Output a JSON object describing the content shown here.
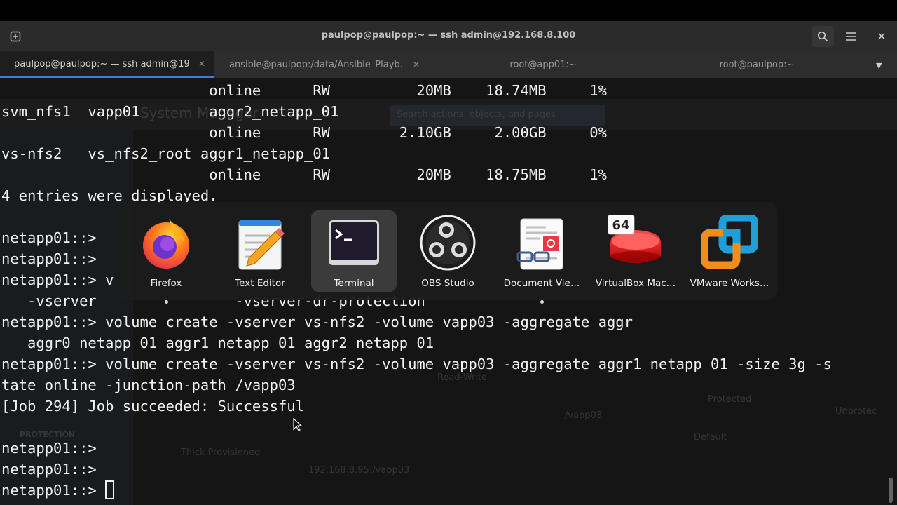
{
  "window": {
    "title": "paulpop@paulpop:~ — ssh admin@192.168.8.100"
  },
  "tabs": [
    {
      "label": "paulpop@paulpop:~ — ssh admin@19…",
      "active": true
    },
    {
      "label": "ansible@paulpop:/data/Ansible_Playb…",
      "active": false
    },
    {
      "label": "root@app01:~",
      "active": false
    },
    {
      "label": "root@paulpop:~",
      "active": false
    }
  ],
  "terminal": {
    "lines": [
      "                        online      RW          20MB    18.74MB     1%",
      "svm_nfs1  vapp01        aggr2_netapp_01",
      "                        online      RW        2.10GB     2.00GB     0%",
      "vs-nfs2   vs_nfs2_root aggr1_netapp_01",
      "                        online      RW          20MB    18.75MB     1%",
      "4 entries were displayed.",
      "",
      "netapp01::>",
      "netapp01::>",
      "netapp01::> v",
      "   -vserver                -vserver-dr-protection",
      "netapp01::> volume create -vserver vs-nfs2 -volume vapp03 -aggregate aggr",
      "   aggr0_netapp_01 aggr1_netapp_01 aggr2_netapp_01",
      "netapp01::> volume create -vserver vs-nfs2 -volume vapp03 -aggregate aggr1_netapp_01 -size 3g -s",
      "tate online -junction-path /vapp03",
      "[Job 294] Job succeeded: Successful",
      "",
      "netapp01::>",
      "netapp01::>"
    ],
    "prompt": "netapp01::> "
  },
  "background_app": {
    "title": "System Manager",
    "search_placeholder": "Search actions, objects, and pages",
    "sidebar_protection": "PROTECTION",
    "labels": [
      "Thick Provisioned",
      "192.168.8.95:/vapp03",
      "/vapp03",
      "Protected",
      "Default",
      "Read-Write",
      "Unprotec"
    ]
  },
  "app_switcher": {
    "selected": "Terminal",
    "apps": [
      {
        "name": "Firefox",
        "icon": "firefox-icon",
        "open": true
      },
      {
        "name": "Text Editor",
        "icon": "text-editor-icon",
        "open": false
      },
      {
        "name": "Terminal",
        "icon": "terminal-icon",
        "open": false
      },
      {
        "name": "OBS Studio",
        "icon": "obs-studio-icon",
        "open": false
      },
      {
        "name": "Document Vie…",
        "icon": "document-viewer-icon",
        "open": true
      },
      {
        "name": "VirtualBox Mac…",
        "icon": "virtualbox-icon",
        "badge": "64",
        "open": false
      },
      {
        "name": "VMware Works…",
        "icon": "vmware-workstation-icon",
        "open": false
      }
    ]
  },
  "colors": {
    "terminal_bg": "#151515",
    "terminal_fg": "#f2f2f2",
    "accent": "#3584e4"
  }
}
